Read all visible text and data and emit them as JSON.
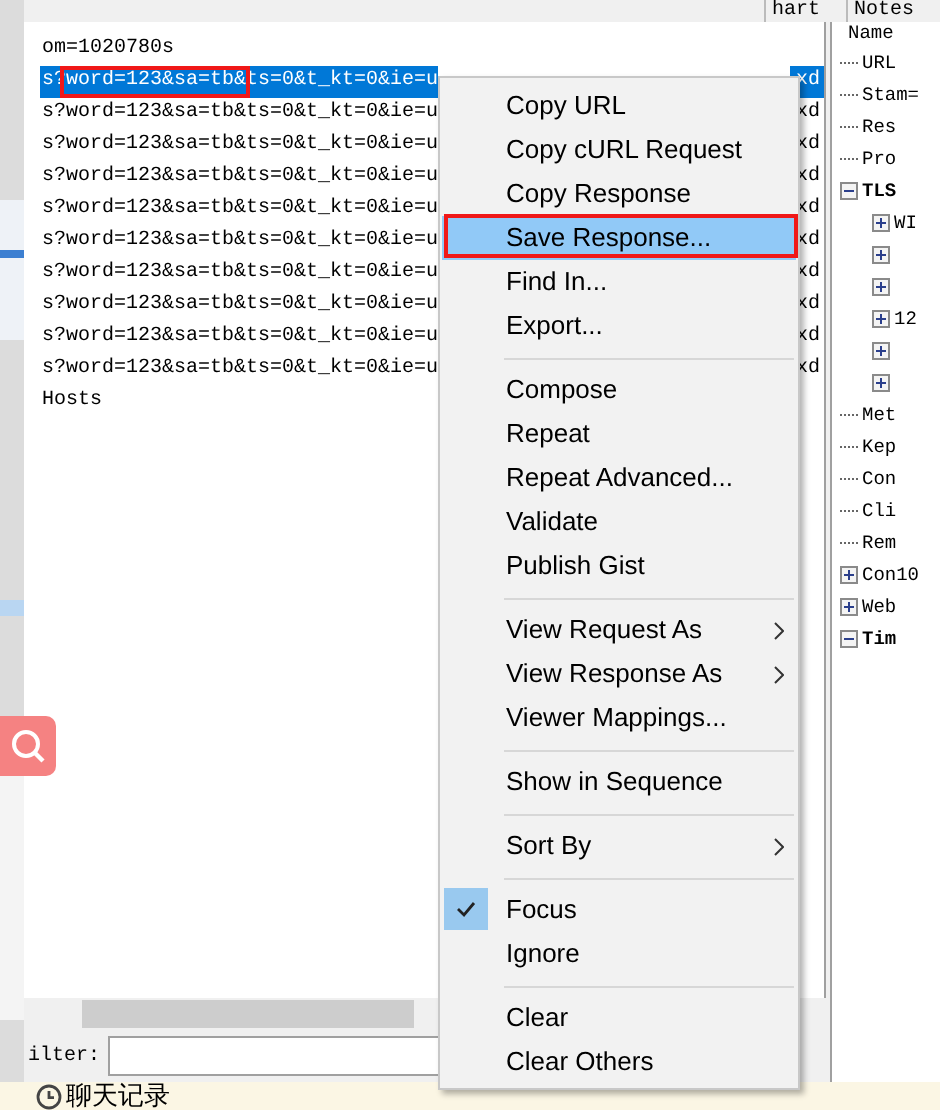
{
  "list": {
    "header": "hart",
    "rows": [
      {
        "text": "om=1020780s",
        "selected": false
      },
      {
        "text": "s?word=123&sa=tb&ts=0&t_kt=0&ie=u",
        "tail": "xd",
        "selected": true
      },
      {
        "text": "s?word=123&sa=tb&ts=0&t_kt=0&ie=u",
        "tail": "xd",
        "selected": false
      },
      {
        "text": "s?word=123&sa=tb&ts=0&t_kt=0&ie=u",
        "tail": "xd",
        "selected": false
      },
      {
        "text": "s?word=123&sa=tb&ts=0&t_kt=0&ie=u",
        "tail": "xd",
        "selected": false
      },
      {
        "text": "s?word=123&sa=tb&ts=0&t_kt=0&ie=u",
        "tail": "xd",
        "selected": false
      },
      {
        "text": "s?word=123&sa=tb&ts=0&t_kt=0&ie=u",
        "tail": "xd",
        "selected": false
      },
      {
        "text": "s?word=123&sa=tb&ts=0&t_kt=0&ie=u",
        "tail": "xd",
        "selected": false
      },
      {
        "text": "s?word=123&sa=tb&ts=0&t_kt=0&ie=u",
        "tail": "xd",
        "selected": false
      },
      {
        "text": "s?word=123&sa=tb&ts=0&t_kt=0&ie=u",
        "tail": "xd",
        "selected": false
      },
      {
        "text": "s?word=123&sa=tb&ts=0&t_kt=0&ie=u",
        "tail": "xd",
        "selected": false
      },
      {
        "text": "Hosts",
        "selected": false
      }
    ]
  },
  "filter": {
    "label": "ilter:"
  },
  "context_menu": [
    {
      "kind": "item",
      "label": "Copy URL",
      "selected": false,
      "checked": false,
      "submenu": false
    },
    {
      "kind": "item",
      "label": "Copy cURL Request",
      "selected": false,
      "checked": false,
      "submenu": false
    },
    {
      "kind": "item",
      "label": "Copy Response",
      "selected": false,
      "checked": false,
      "submenu": false
    },
    {
      "kind": "item",
      "label": "Save Response...",
      "selected": true,
      "checked": false,
      "submenu": false
    },
    {
      "kind": "item",
      "label": "Find In...",
      "selected": false,
      "checked": false,
      "submenu": false
    },
    {
      "kind": "item",
      "label": "Export...",
      "selected": false,
      "checked": false,
      "submenu": false
    },
    {
      "kind": "separator"
    },
    {
      "kind": "item",
      "label": "Compose",
      "selected": false,
      "checked": false,
      "submenu": false
    },
    {
      "kind": "item",
      "label": "Repeat",
      "selected": false,
      "checked": false,
      "submenu": false
    },
    {
      "kind": "item",
      "label": "Repeat Advanced...",
      "selected": false,
      "checked": false,
      "submenu": false
    },
    {
      "kind": "item",
      "label": "Validate",
      "selected": false,
      "checked": false,
      "submenu": false
    },
    {
      "kind": "item",
      "label": "Publish Gist",
      "selected": false,
      "checked": false,
      "submenu": false
    },
    {
      "kind": "separator"
    },
    {
      "kind": "item",
      "label": "View Request As",
      "selected": false,
      "checked": false,
      "submenu": true
    },
    {
      "kind": "item",
      "label": "View Response As",
      "selected": false,
      "checked": false,
      "submenu": true
    },
    {
      "kind": "item",
      "label": "Viewer Mappings...",
      "selected": false,
      "checked": false,
      "submenu": false
    },
    {
      "kind": "separator"
    },
    {
      "kind": "item",
      "label": "Show in Sequence",
      "selected": false,
      "checked": false,
      "submenu": false
    },
    {
      "kind": "separator"
    },
    {
      "kind": "item",
      "label": "Sort By",
      "selected": false,
      "checked": false,
      "submenu": true
    },
    {
      "kind": "separator"
    },
    {
      "kind": "item",
      "label": "Focus",
      "selected": false,
      "checked": true,
      "submenu": false
    },
    {
      "kind": "item",
      "label": "Ignore",
      "selected": false,
      "checked": false,
      "submenu": false
    },
    {
      "kind": "separator"
    },
    {
      "kind": "item",
      "label": "Clear",
      "selected": false,
      "checked": false,
      "submenu": false
    },
    {
      "kind": "item",
      "label": "Clear Others",
      "selected": false,
      "checked": false,
      "submenu": false
    }
  ],
  "side_panel": {
    "header": "Notes",
    "tree_heading": "Name",
    "tree": [
      {
        "label": "URL"
      },
      {
        "label": "Stam="
      },
      {
        "label": "Res"
      },
      {
        "label": "Pro"
      },
      {
        "label": "TLS",
        "expanded": true,
        "children": [
          {
            "label": "WI",
            "expanded": false
          },
          {
            "expanded": false
          },
          {
            "expanded": false
          },
          {
            "label": "12",
            "expanded": false
          },
          {
            "expanded": false
          },
          {
            "expanded": false
          }
        ]
      },
      {
        "label": "Met"
      },
      {
        "label": "Kep"
      },
      {
        "label": "Con"
      },
      {
        "label": "Cli"
      },
      {
        "label": "Rem"
      },
      {
        "label": "Con10",
        "expanded": false
      },
      {
        "label": "Web",
        "expanded": false
      },
      {
        "label": "Tim",
        "expanded": true
      }
    ]
  },
  "footer": {
    "label": "聊天记录"
  }
}
